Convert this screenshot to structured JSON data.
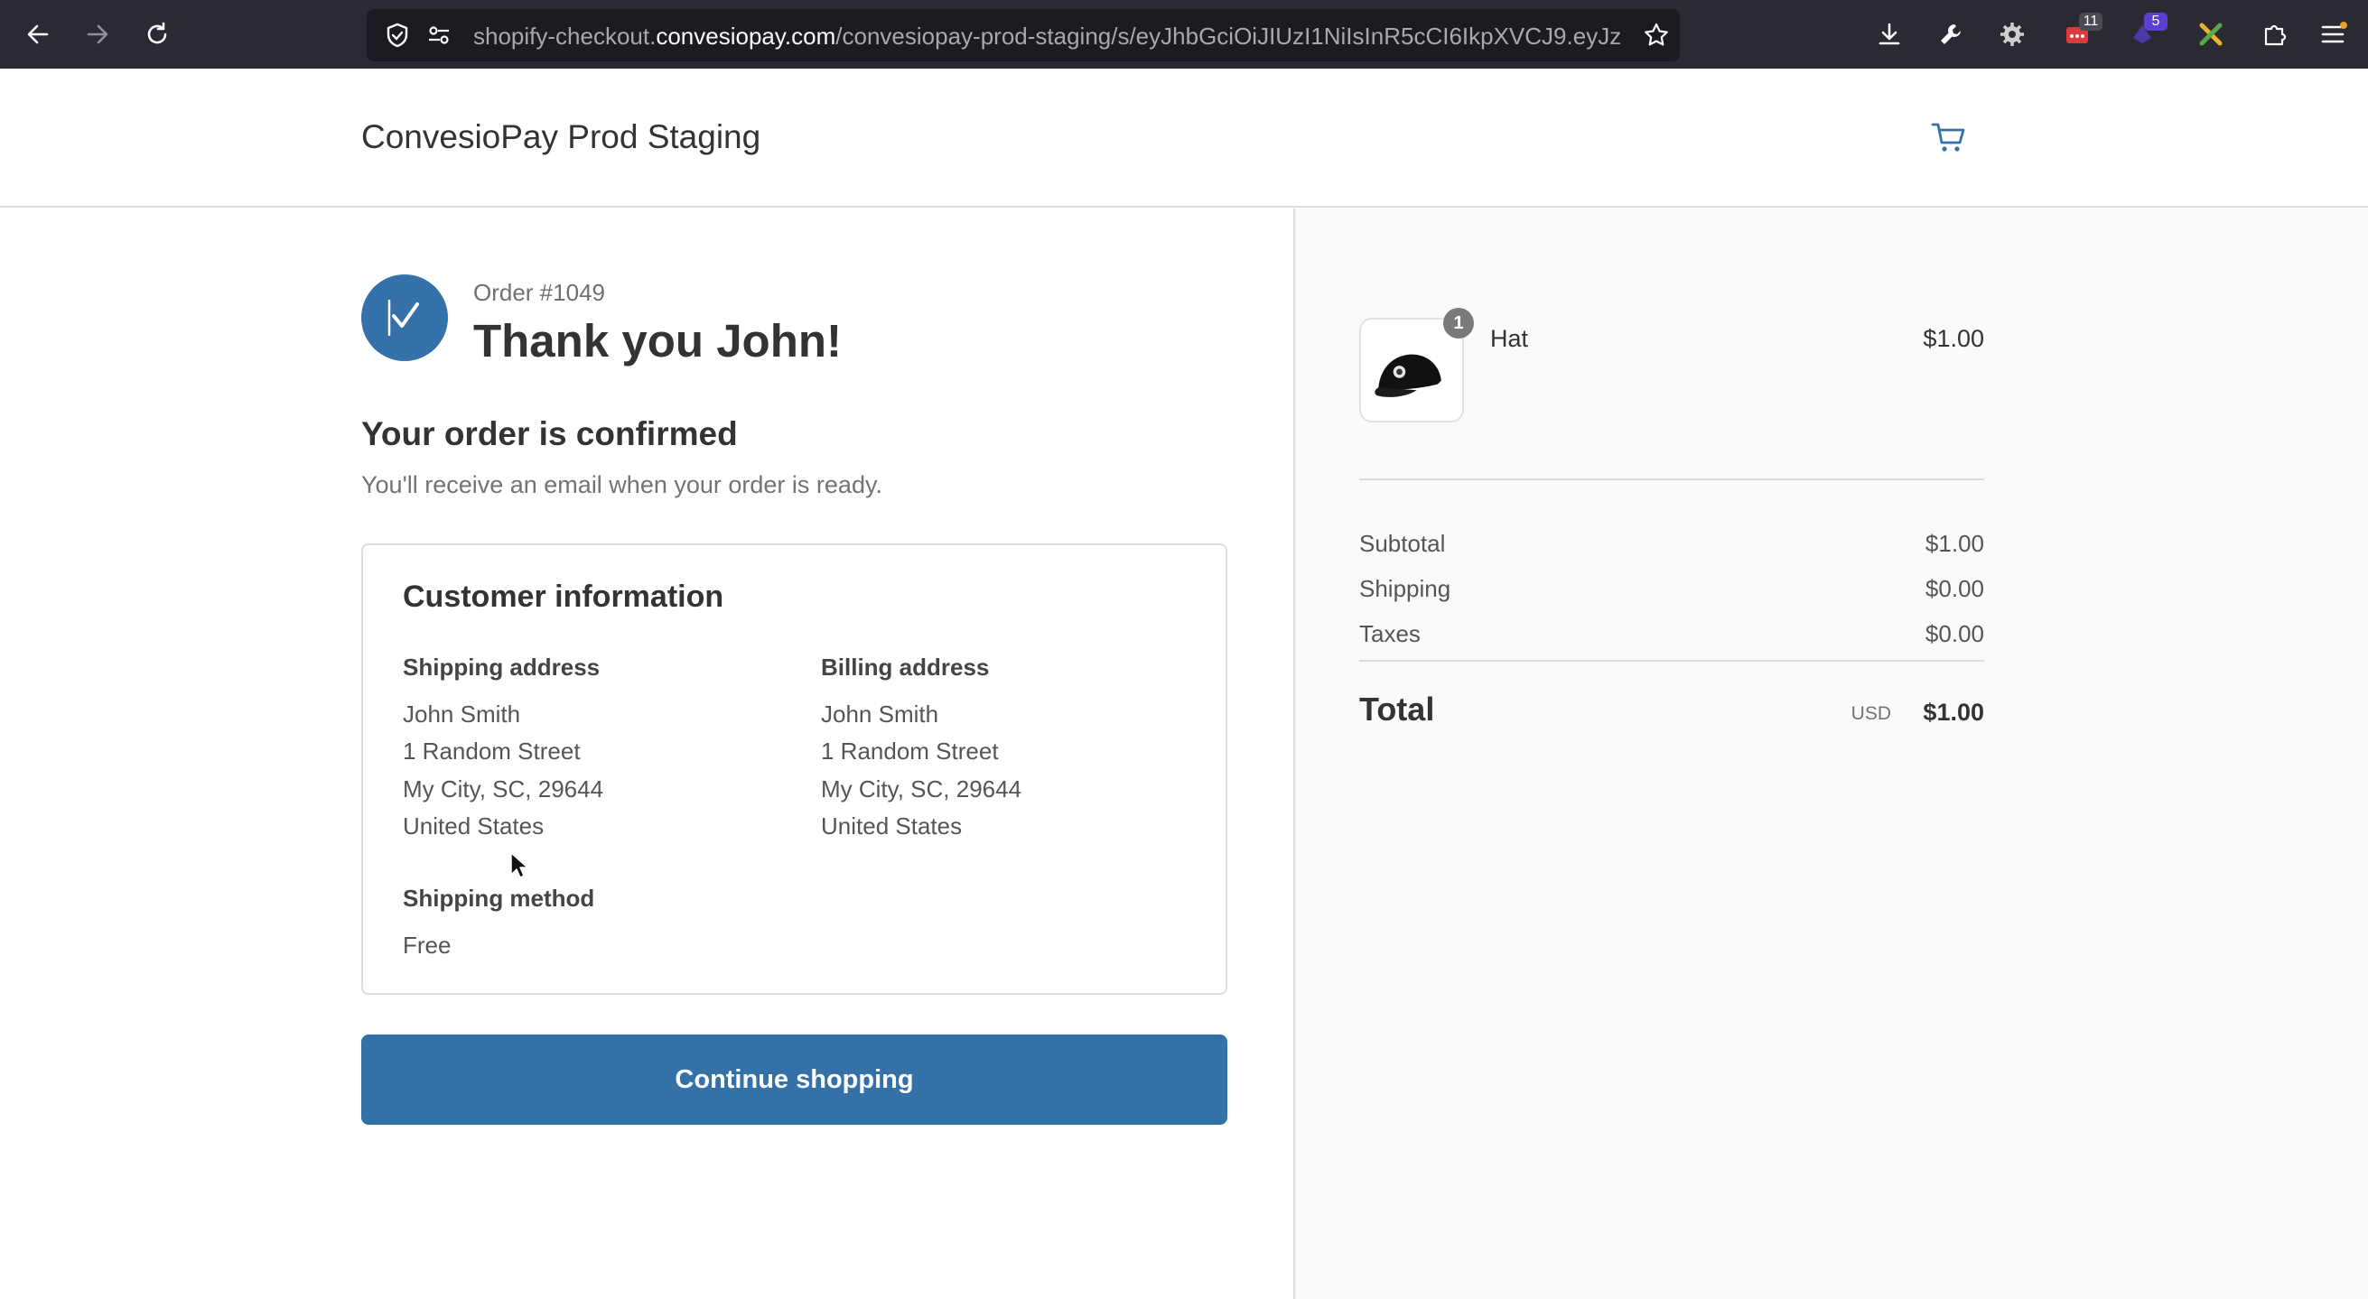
{
  "browser": {
    "url_prefix": "shopify-checkout.",
    "url_host": "convesiopay.com",
    "url_path": "/convesiopay-prod-staging/s/eyJhbGciOiJIUzI1NiIsInR5cCI6IkpXVCJ9.eyJz",
    "extension_badges": [
      "11",
      "5"
    ],
    "icons": [
      "back-arrow-icon",
      "forward-arrow-icon",
      "reload-icon",
      "shield-icon",
      "permissions-icon",
      "bookmark-star-icon",
      "download-icon",
      "wrench-icon",
      "gear-icon",
      "extension-icon",
      "puzzle-icon",
      "menu-icon"
    ]
  },
  "header": {
    "shop_name": "ConvesioPay Prod Staging"
  },
  "order": {
    "number_label": "Order #1049",
    "thanks": "Thank you John!",
    "confirmed_title": "Your order is confirmed",
    "email_note": "You'll receive an email when your order is ready."
  },
  "customer_info": {
    "title": "Customer information",
    "shipping_address": {
      "heading": "Shipping address",
      "lines": [
        "John Smith",
        "1 Random Street",
        "My City, SC, 29644",
        "United States"
      ]
    },
    "billing_address": {
      "heading": "Billing address",
      "lines": [
        "John Smith",
        "1 Random Street",
        "My City, SC, 29644",
        "United States"
      ]
    },
    "shipping_method": {
      "heading": "Shipping method",
      "value": "Free"
    }
  },
  "actions": {
    "continue_label": "Continue shopping"
  },
  "summary": {
    "item": {
      "name": "Hat",
      "quantity": "1",
      "price": "$1.00"
    },
    "subtotal_label": "Subtotal",
    "subtotal": "$1.00",
    "shipping_label": "Shipping",
    "shipping": "$0.00",
    "taxes_label": "Taxes",
    "taxes": "$0.00",
    "total_label": "Total",
    "currency": "USD",
    "total": "$1.00"
  },
  "colors": {
    "accent": "#3571a9",
    "browser_chrome": "#2b2a33",
    "summary_bg": "#fafafa"
  }
}
